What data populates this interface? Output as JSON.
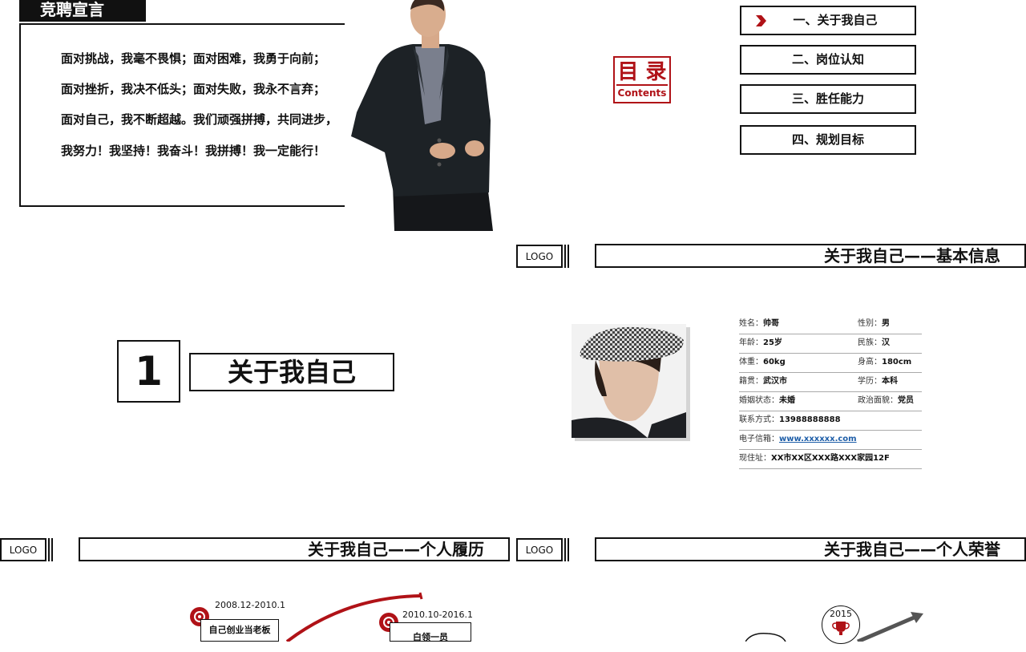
{
  "slide1": {
    "tag": "竞聘宣言",
    "lines": [
      "面对挑战，我毫不畏惧；面对困难，我勇于向前；",
      "面对挫折，我决不低头；面对失败，我永不言弃；",
      "面对自己，我不断超越。我们顽强拼搏，共同进步，",
      "我努力！我坚持！我奋斗！我拼搏！我一定能行！"
    ]
  },
  "slide2": {
    "mulu_title": "目 录",
    "mulu_sub": "Contents",
    "menu": [
      "一、关于我自己",
      "二、岗位认知",
      "三、胜任能力",
      "四、规划目标"
    ]
  },
  "slide3": {
    "number": "1",
    "title": "关于我自己"
  },
  "logo": "LOGO",
  "slide4": {
    "header": "关于我自己——基本信息",
    "rows": [
      {
        "k1": "姓名：",
        "v1": "帅哥",
        "k2": "性别：",
        "v2": "男"
      },
      {
        "k1": "年龄：",
        "v1": "25岁",
        "k2": "民族：",
        "v2": "汉"
      },
      {
        "k1": "体重：",
        "v1": "60kg",
        "k2": "身高：",
        "v2": "180cm"
      },
      {
        "k1": "籍贯：",
        "v1": "武汉市",
        "k2": "学历：",
        "v2": "本科"
      },
      {
        "k1": "婚姻状态：",
        "v1": "未婚",
        "k2": "政治面貌：",
        "v2": "党员"
      }
    ],
    "phone_k": "联系方式：",
    "phone_v": "13988888888",
    "email_k": "电子信箱：",
    "email_v": "www.xxxxxx.com",
    "addr_k": "现住址：",
    "addr_v": "XX市XX区XXX路XXX家园12F"
  },
  "slide5": {
    "header": "关于我自己——个人履历",
    "items": [
      {
        "date": "2008.12-2010.1",
        "label": "自己创业当老板"
      },
      {
        "date": "2010.10-2016.1",
        "label": "白领一员"
      }
    ]
  },
  "slide6": {
    "header": "关于我自己——个人荣誉",
    "year": "2015"
  },
  "colors": {
    "accent": "#b01217",
    "ink": "#111111",
    "link": "#1e5ea8"
  }
}
